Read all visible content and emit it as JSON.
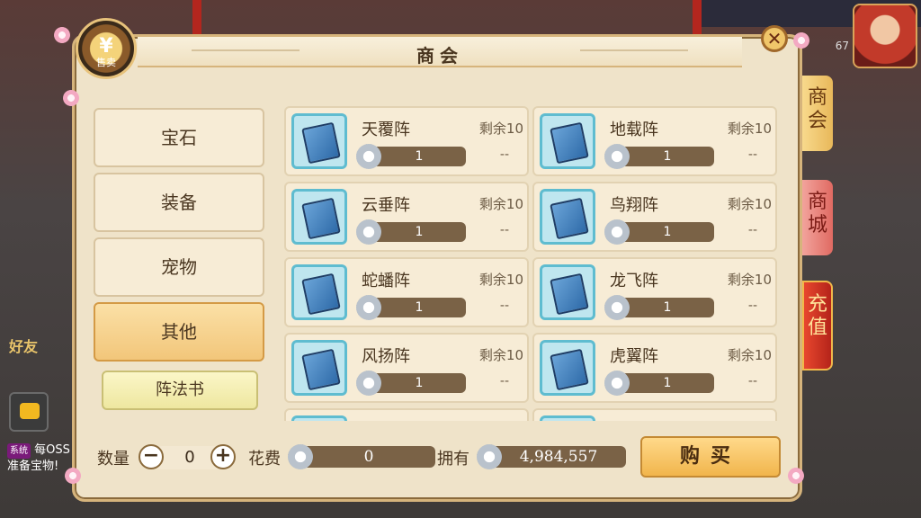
{
  "window": {
    "title": "商会"
  },
  "emblem": {
    "glyph": "¥",
    "label": "售卖"
  },
  "hud": {
    "level": "67",
    "friend_label": "好友",
    "chat": {
      "tag": "系统",
      "text": "每OSS准备宝物!"
    }
  },
  "categories": [
    {
      "label": "宝石",
      "active": false
    },
    {
      "label": "装备",
      "active": false
    },
    {
      "label": "宠物",
      "active": false
    },
    {
      "label": "其他",
      "active": true
    }
  ],
  "subcategory": {
    "label": "阵法书"
  },
  "items": [
    {
      "name": "天覆阵",
      "remain": "剩余10",
      "price": "1",
      "stock": "--"
    },
    {
      "name": "地载阵",
      "remain": "剩余10",
      "price": "1",
      "stock": "--"
    },
    {
      "name": "云垂阵",
      "remain": "剩余10",
      "price": "1",
      "stock": "--"
    },
    {
      "name": "鸟翔阵",
      "remain": "剩余10",
      "price": "1",
      "stock": "--"
    },
    {
      "name": "蛇蟠阵",
      "remain": "剩余10",
      "price": "1",
      "stock": "--"
    },
    {
      "name": "龙飞阵",
      "remain": "剩余10",
      "price": "1",
      "stock": "--"
    },
    {
      "name": "风扬阵",
      "remain": "剩余10",
      "price": "1",
      "stock": "--"
    },
    {
      "name": "虎翼阵",
      "remain": "剩余10",
      "price": "1",
      "stock": "--"
    },
    {
      "name": "",
      "remain": "",
      "price": "",
      "stock": ""
    },
    {
      "name": "",
      "remain": "",
      "price": "",
      "stock": ""
    }
  ],
  "footer": {
    "quantity_label": "数量",
    "minus": "−",
    "plus": "+",
    "quantity_value": "0",
    "cost_label": "花费",
    "cost_value": "0",
    "own_label": "拥有",
    "own_value": "4,984,557",
    "buy_label": "购买"
  },
  "side_tabs": [
    {
      "label": "商会"
    },
    {
      "label": "商城"
    },
    {
      "label": "充值"
    }
  ]
}
